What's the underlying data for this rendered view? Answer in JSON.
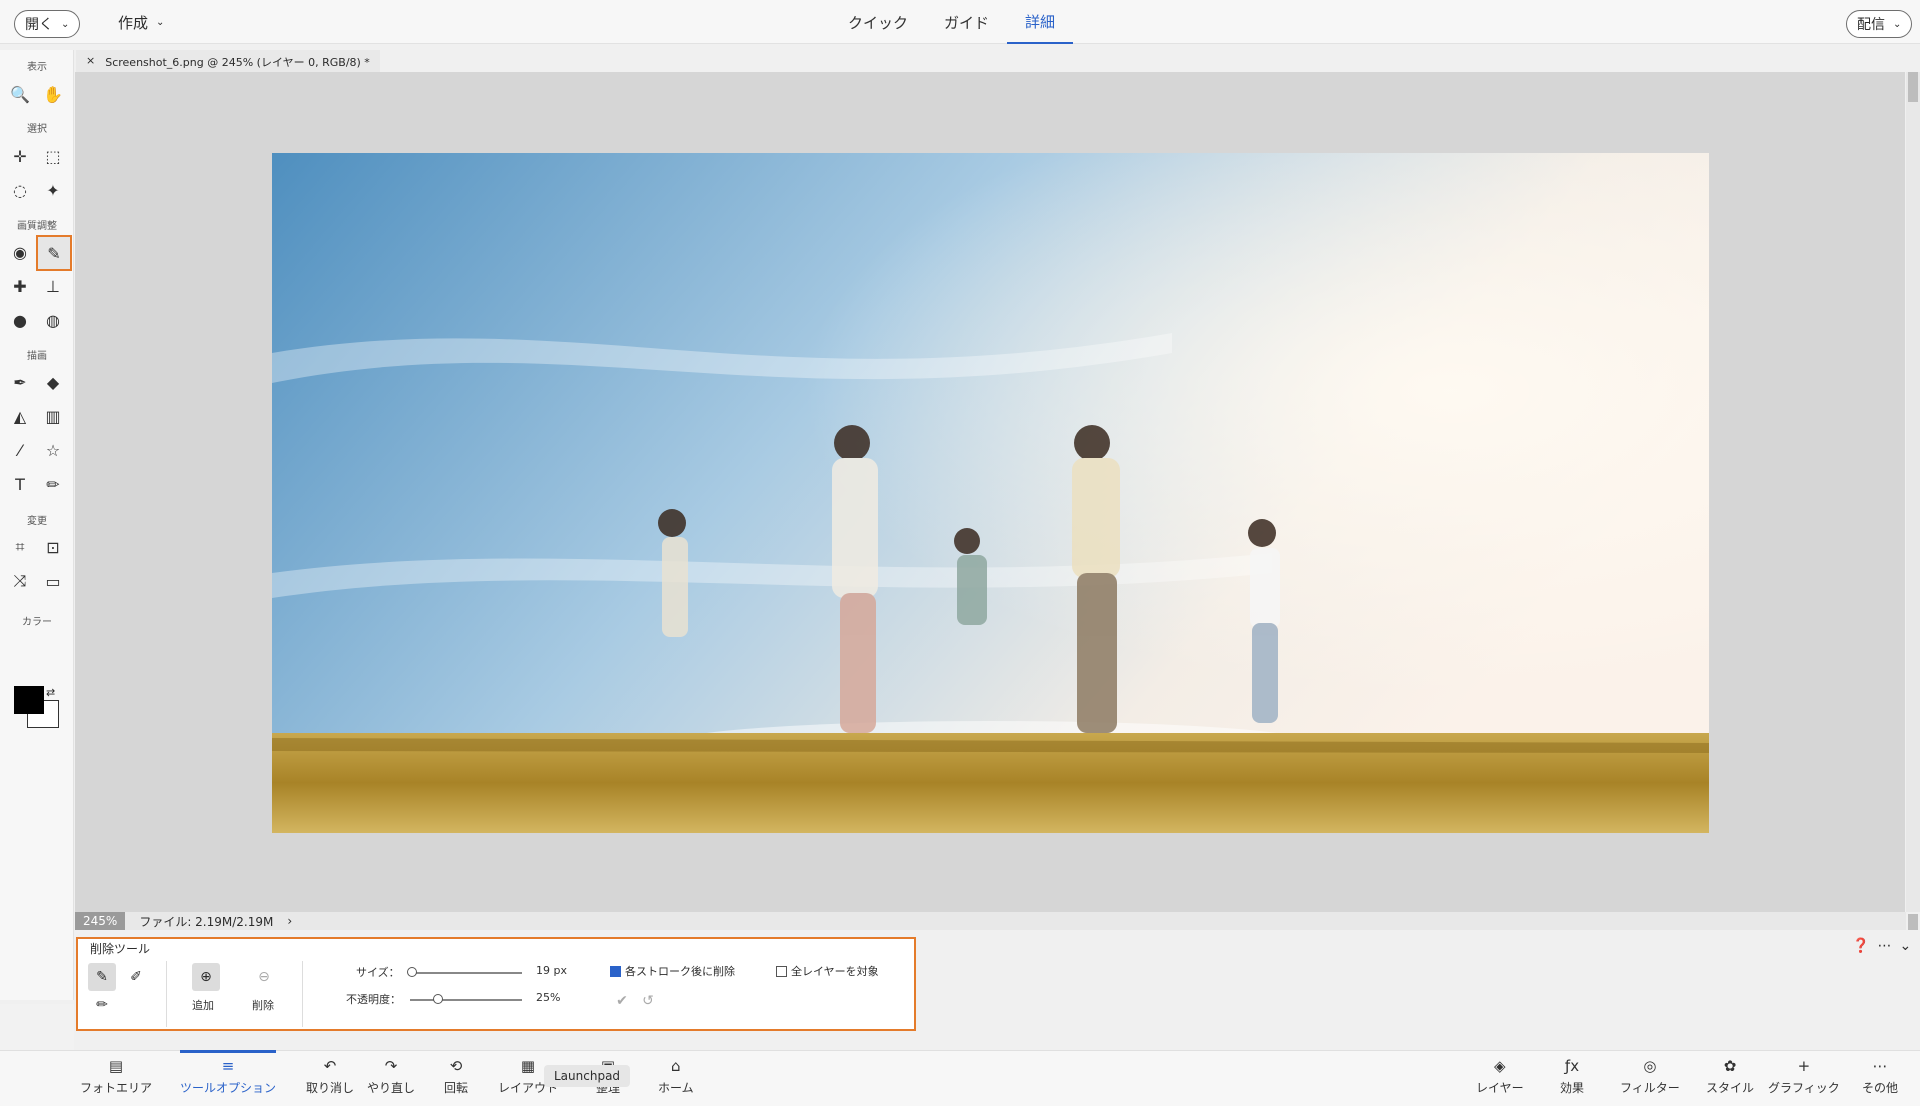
{
  "topbar": {
    "open_label": "開く",
    "create_label": "作成",
    "modes": [
      {
        "label": "クイック",
        "active": false
      },
      {
        "label": "ガイド",
        "active": false
      },
      {
        "label": "詳細",
        "active": true
      }
    ],
    "share_label": "配信"
  },
  "toolbar": {
    "sections": [
      "表示",
      "選択",
      "画質調整",
      "描画",
      "変更",
      "カラー"
    ]
  },
  "document": {
    "tab_title": "Screenshot_6.png @ 245% (レイヤー 0, RGB/8) *"
  },
  "status": {
    "zoom": "245%",
    "file_info": "ファイル: 2.19M/2.19M"
  },
  "options": {
    "title": "削除ツール",
    "add_label": "追加",
    "remove_label": "削除",
    "size_label": "サイズ：",
    "size_value": "19 px",
    "opacity_label": "不透明度：",
    "opacity_value": "25%",
    "size_level": 0.02,
    "opacity_level": 0.25,
    "delete_after_stroke": {
      "label": "各ストローク後に削除",
      "checked": true
    },
    "all_layers": {
      "label": "全レイヤーを対象",
      "checked": false
    }
  },
  "bottombar": {
    "items_left": [
      {
        "label": "フォトエリア",
        "icon": "folder-icon"
      },
      {
        "label": "ツールオプション",
        "icon": "tool-options-icon",
        "active": true
      },
      {
        "label": "取り消し",
        "icon": "undo-icon"
      },
      {
        "label": "やり直し",
        "icon": "redo-icon"
      },
      {
        "label": "回転",
        "icon": "rotate-icon"
      },
      {
        "label": "レイアウト",
        "icon": "layout-icon"
      },
      {
        "label": "整理",
        "icon": "organizer-icon"
      },
      {
        "label": "ホーム",
        "icon": "home-icon"
      }
    ],
    "items_right": [
      {
        "label": "レイヤー",
        "icon": "layers-icon"
      },
      {
        "label": "効果",
        "icon": "fx-icon"
      },
      {
        "label": "フィルター",
        "icon": "filter-icon"
      },
      {
        "label": "スタイル",
        "icon": "style-icon"
      },
      {
        "label": "グラフィック",
        "icon": "graphic-icon"
      },
      {
        "label": "その他",
        "icon": "more-icon"
      }
    ],
    "tooltip": "Launchpad"
  }
}
